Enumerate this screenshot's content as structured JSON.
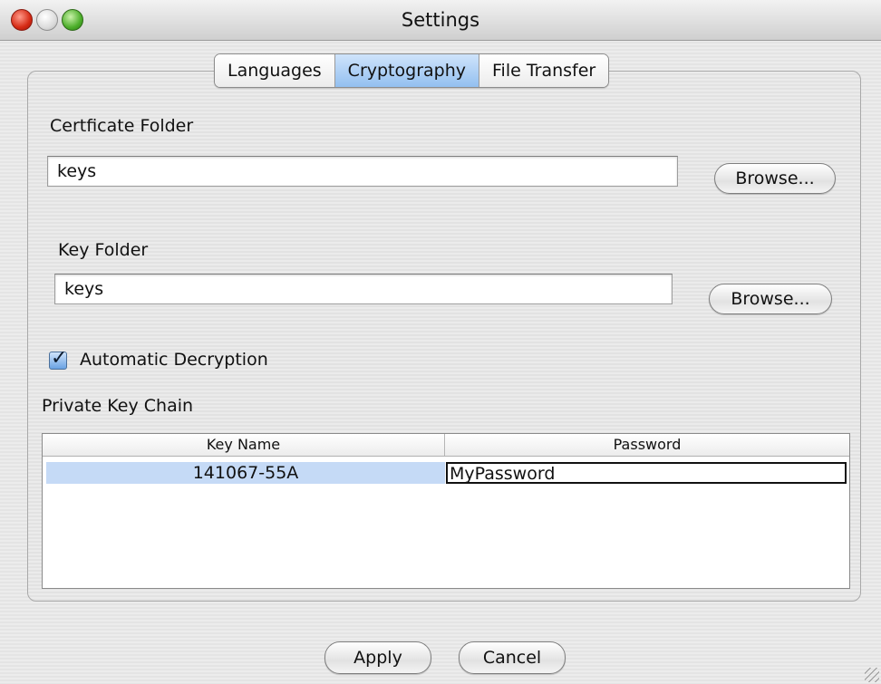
{
  "window": {
    "title": "Settings",
    "controls": {
      "close": "close-button",
      "minimize": "minimize-button",
      "maximize": "zoom-button"
    }
  },
  "tabs": [
    {
      "label": "Languages",
      "active": false
    },
    {
      "label": "Cryptography",
      "active": true
    },
    {
      "label": "File Transfer",
      "active": false
    }
  ],
  "certificate": {
    "label": "Certficate Folder",
    "value": "keys",
    "browse": "Browse..."
  },
  "key": {
    "label": "Key Folder",
    "value": "keys",
    "browse": "Browse..."
  },
  "auto_decrypt": {
    "label": "Automatic Decryption",
    "checked": true
  },
  "keychain": {
    "label": "Private Key Chain",
    "columns": [
      "Key Name",
      "Password"
    ],
    "rows": [
      {
        "key_name": "141067-55A",
        "password": "MyPassword"
      }
    ]
  },
  "footer": {
    "apply": "Apply",
    "cancel": "Cancel"
  }
}
